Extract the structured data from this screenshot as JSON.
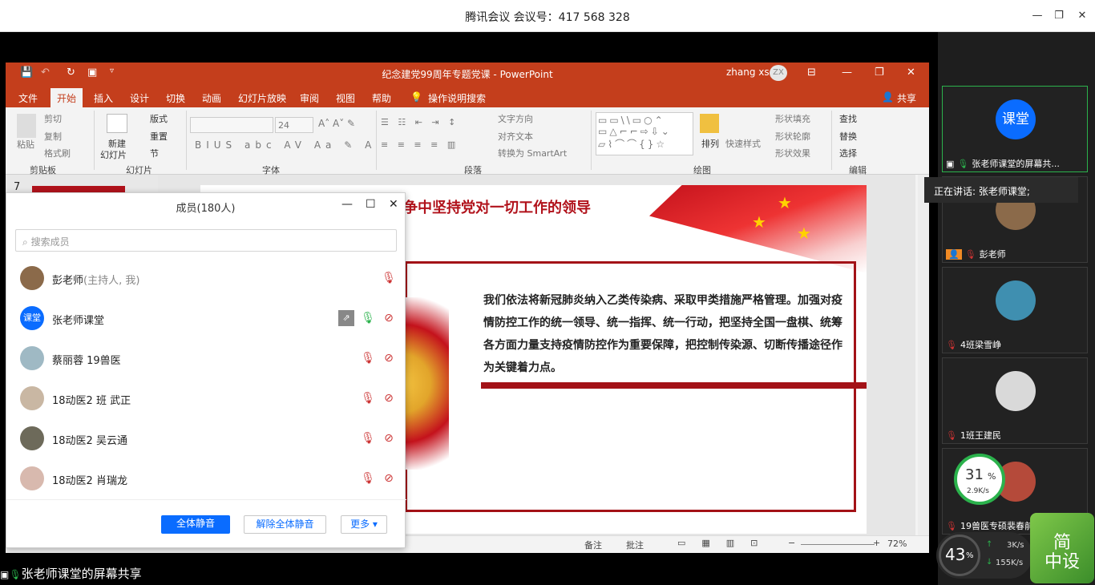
{
  "window": {
    "title": "腾讯会议 会议号：417 568 328"
  },
  "ppt": {
    "title": "纪念建党99周年专题党课  -  PowerPoint",
    "user": "zhang xs",
    "user_initials": "ZX",
    "tabs": [
      "文件",
      "开始",
      "插入",
      "设计",
      "切换",
      "动画",
      "幻灯片放映",
      "审阅",
      "视图",
      "帮助",
      "操作说明搜索"
    ],
    "share": "共享",
    "ribbon": {
      "clipboard": {
        "paste": "粘贴",
        "cut": "剪切",
        "copy": "复制",
        "format_painter": "格式刷",
        "group": "剪贴板"
      },
      "slides": {
        "new_slide": "新建",
        "new_slide2": "幻灯片",
        "layout": "版式",
        "reset": "重置",
        "section": "节",
        "group": "幻灯片"
      },
      "font": {
        "size": "24",
        "group": "字体"
      },
      "paragraph": {
        "text_dir": "文字方向",
        "align_text": "对齐文本",
        "smartart": "转换为 SmartArt",
        "group": "段落"
      },
      "drawing": {
        "arrange": "排列",
        "quick_styles": "快速样式",
        "fill": "形状填充",
        "outline": "形状轮廓",
        "effects": "形状效果",
        "group": "绘图"
      },
      "editing": {
        "find": "查找",
        "replace": "替换",
        "select": "选择",
        "group": "编辑"
      }
    },
    "thumb_number": "7",
    "slide": {
      "headline": "争中坚持党对一切工作的领导",
      "body": "我们依法将新冠肺炎纳入乙类传染病、采取甲类措施严格管理。加强对疫情防控工作的统一领导、统一指挥、统一行动，把坚持全国一盘棋、统筹各方面力量支持疫情防控作为重要保障，把控制传染源、切断传播途径作为关键着力点。"
    },
    "status": {
      "notes": "备注",
      "comments": "批注",
      "zoom": "72%",
      "minus": "−",
      "plus": "+"
    }
  },
  "members": {
    "title": "成员(180人)",
    "search_placeholder": "搜索成员",
    "list": [
      {
        "name": "彭老师",
        "role": "(主持人, 我)"
      },
      {
        "name": "张老师课堂",
        "role": ""
      },
      {
        "name": "蔡丽蓉 19兽医",
        "role": ""
      },
      {
        "name": "18动医2 班 武正",
        "role": ""
      },
      {
        "name": "18动医2 吴云通",
        "role": ""
      },
      {
        "name": "18动医2 肖瑞龙",
        "role": ""
      }
    ],
    "avatar_text": "课堂",
    "mute_all": "全体静音",
    "unmute_all": "解除全体静音",
    "more": "更多"
  },
  "participants": [
    {
      "label": "张老师课堂的屏幕共...",
      "avatar": "课堂"
    },
    {
      "label": "彭老师"
    },
    {
      "label": "4班梁雪峥"
    },
    {
      "label": "1班王建民"
    },
    {
      "label": "19兽医专硕裴春前"
    }
  ],
  "speaking": "正在讲话: 张老师课堂;",
  "network": {
    "cpu": "31",
    "cpu_unit": "%",
    "speed": "2.9K/s",
    "mem": "43",
    "mem_unit": "%",
    "up": "3K/s",
    "down": "155K/s"
  },
  "logo": "简\n中设",
  "share_caption": "张老师课堂的屏幕共享",
  "colors": {
    "ppt_accent": "#c43e1c",
    "tencent_blue": "#0a6cff",
    "primary_button": "#0a6cff"
  }
}
